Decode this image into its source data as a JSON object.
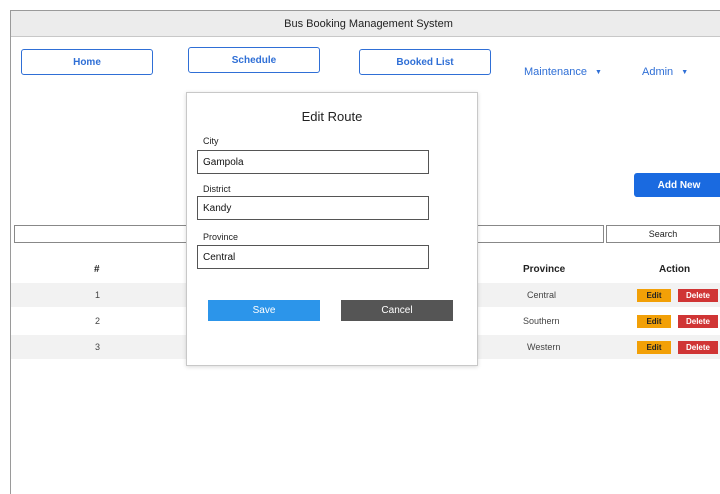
{
  "window": {
    "title": "Bus Booking Management System"
  },
  "nav": {
    "home": "Home",
    "schedule": "Schedule",
    "booked_list": "Booked List",
    "maintenance": "Maintenance",
    "admin": "Admin"
  },
  "toolbar": {
    "add_new": "Add New",
    "search_button": "Search",
    "search_value": ""
  },
  "table": {
    "headers": {
      "num": "#",
      "province": "Province",
      "action": "Action"
    },
    "rows": [
      {
        "num": "1",
        "province": "Central",
        "edit": "Edit",
        "delete": "Delete"
      },
      {
        "num": "2",
        "province": "Southern",
        "edit": "Edit",
        "delete": "Delete"
      },
      {
        "num": "3",
        "province": "Western",
        "edit": "Edit",
        "delete": "Delete"
      }
    ]
  },
  "modal": {
    "title": "Edit Route",
    "city_label": "City",
    "city_value": "Gampola",
    "district_label": "District",
    "district_value": "Kandy",
    "province_label": "Province",
    "province_value": "Central",
    "save": "Save",
    "cancel": "Cancel"
  },
  "colors": {
    "primary": "#1a6ae0",
    "nav_text": "#2f6fd6",
    "edit_badge": "#f2a007",
    "delete_badge": "#d03535",
    "save_button": "#2c95ea",
    "cancel_button": "#555555"
  },
  "icons": {
    "dropdown": "chevron-down-icon"
  }
}
